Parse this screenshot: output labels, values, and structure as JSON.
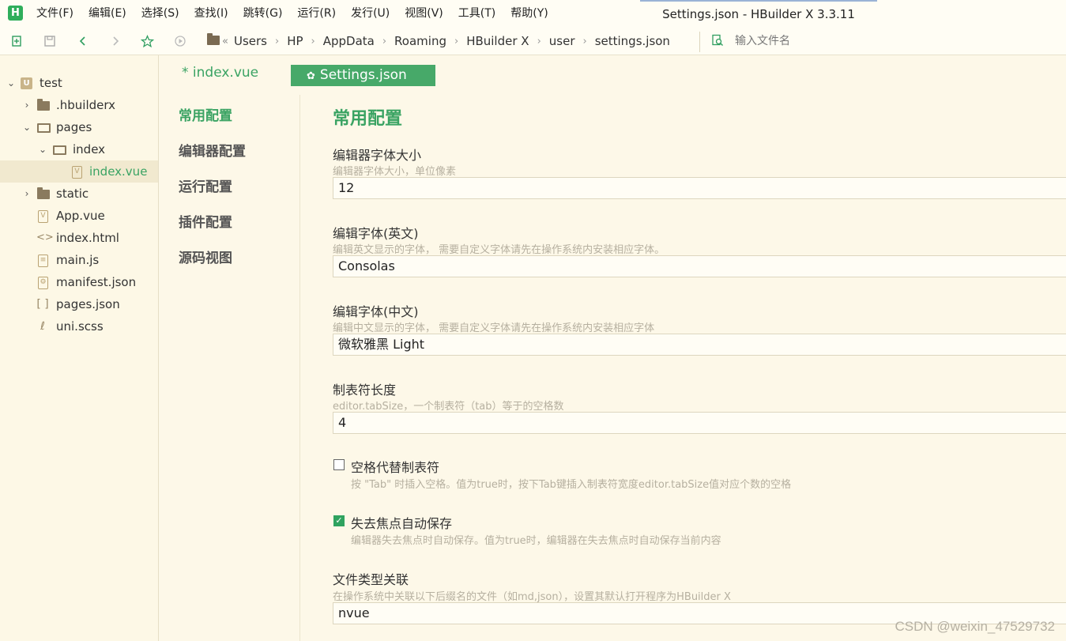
{
  "app": {
    "logo_letter": "H",
    "window_title": "Settings.json - HBuilder X 3.3.11"
  },
  "menu": [
    "文件(F)",
    "编辑(E)",
    "选择(S)",
    "查找(I)",
    "跳转(G)",
    "运行(R)",
    "发行(U)",
    "视图(V)",
    "工具(T)",
    "帮助(Y)"
  ],
  "toolbar": {
    "icons": [
      "new-file-icon",
      "save-icon",
      "back-icon",
      "forward-icon",
      "star-icon",
      "run-icon"
    ],
    "breadcrumb_start": "«",
    "breadcrumb": [
      "Users",
      "HP",
      "AppData",
      "Roaming",
      "HBuilder X",
      "user",
      "settings.json"
    ],
    "breadcrumb_sep": "›",
    "file_search_placeholder": "输入文件名"
  },
  "sidebar": {
    "project": "test",
    "items": [
      {
        "label": ".hbuilderx",
        "type": "folder"
      },
      {
        "label": "pages",
        "type": "folder-open"
      },
      {
        "label": "index",
        "type": "folder-open"
      },
      {
        "label": "index.vue",
        "type": "vue",
        "selected": true
      },
      {
        "label": "static",
        "type": "folder"
      },
      {
        "label": "App.vue",
        "type": "vue"
      },
      {
        "label": "index.html",
        "type": "html"
      },
      {
        "label": "main.js",
        "type": "js"
      },
      {
        "label": "manifest.json",
        "type": "json-manifest"
      },
      {
        "label": "pages.json",
        "type": "json"
      },
      {
        "label": "uni.scss",
        "type": "scss"
      }
    ]
  },
  "tabs": {
    "index": "* index.vue",
    "settings": "Settings.json",
    "settings_icon": "gear-icon"
  },
  "settings_nav": [
    "常用配置",
    "编辑器配置",
    "运行配置",
    "插件配置",
    "源码视图"
  ],
  "settings": {
    "section_title": "常用配置",
    "fields": [
      {
        "label": "编辑器字体大小",
        "desc": "编辑器字体大小，单位像素",
        "value": "12"
      },
      {
        "label": "编辑字体(英文)",
        "desc": "编辑英文显示的字体， 需要自定义字体请先在操作系统内安装相应字体。",
        "value": "Consolas"
      },
      {
        "label": "编辑字体(中文)",
        "desc": "编辑中文显示的字体， 需要自定义字体请先在操作系统内安装相应字体",
        "value": "微软雅黑 Light"
      },
      {
        "label": "制表符长度",
        "desc": "editor.tabSize，一个制表符（tab）等于的空格数",
        "value": "4"
      }
    ],
    "checkboxes": [
      {
        "label": "空格代替制表符",
        "desc": "按 \"Tab\" 时插入空格。值为true时，按下Tab键插入制表符宽度editor.tabSize值对应个数的空格",
        "checked": false
      },
      {
        "label": "失去焦点自动保存",
        "desc": "编辑器失去焦点时自动保存。值为true时，编辑器在失去焦点时自动保存当前内容",
        "checked": true
      }
    ],
    "last_field": {
      "label": "文件类型关联",
      "desc": "在操作系统中关联以下后缀名的文件（如md,json），设置其默认打开程序为HBuilder X",
      "value": "nvue"
    }
  },
  "watermark": "CSDN @weixin_47529732",
  "colors": {
    "accent": "#3aa363",
    "background": "#fdf8e8",
    "tab_active": "#47a969"
  }
}
